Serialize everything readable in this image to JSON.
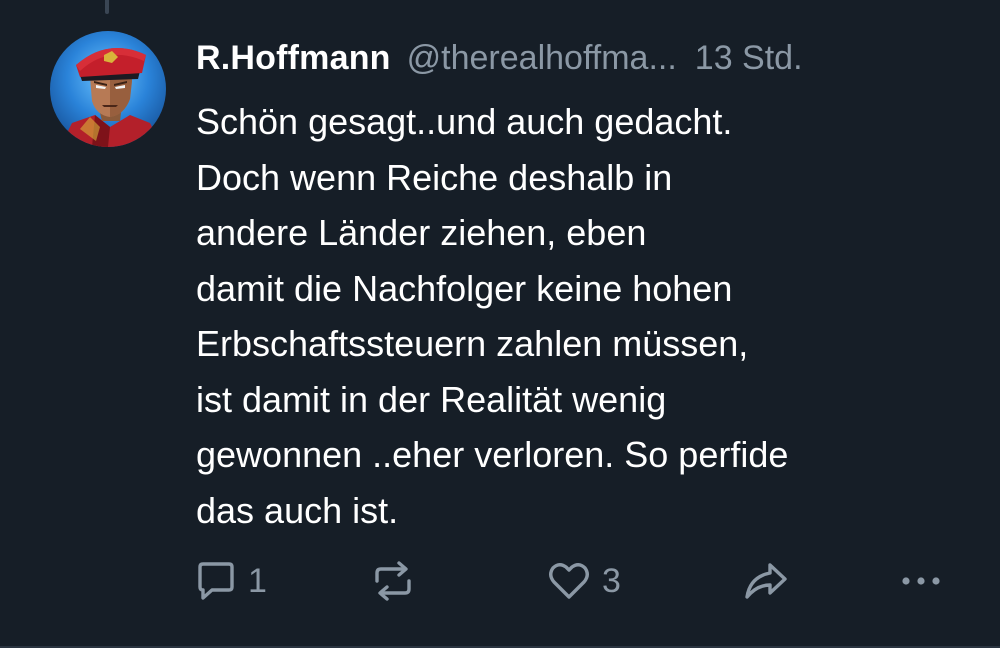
{
  "post": {
    "author_name": "R.Hoffmann",
    "author_handle": "@therealhoffma...",
    "timestamp": "13 Std.",
    "text_lines": [
      "Schön gesagt..und auch gedacht.",
      "Doch wenn Reiche deshalb in",
      "andere Länder ziehen, eben",
      "damit die Nachfolger keine hohen",
      "Erbschaftssteuern zahlen müssen,",
      "ist damit in der Realität wenig",
      "gewonnen ..eher verloren. So perfide",
      "das auch ist."
    ]
  },
  "actions": {
    "reply": {
      "icon": "reply-icon",
      "count": "1"
    },
    "repost": {
      "icon": "repost-icon"
    },
    "like": {
      "icon": "heart-icon",
      "count": "3"
    },
    "share": {
      "icon": "share-icon"
    },
    "more": {
      "icon": "more-options-icon"
    }
  },
  "colors": {
    "background": "#161e27",
    "text_primary": "#ffffff",
    "text_secondary": "#8b98a5",
    "thread_line": "#3a4654"
  }
}
